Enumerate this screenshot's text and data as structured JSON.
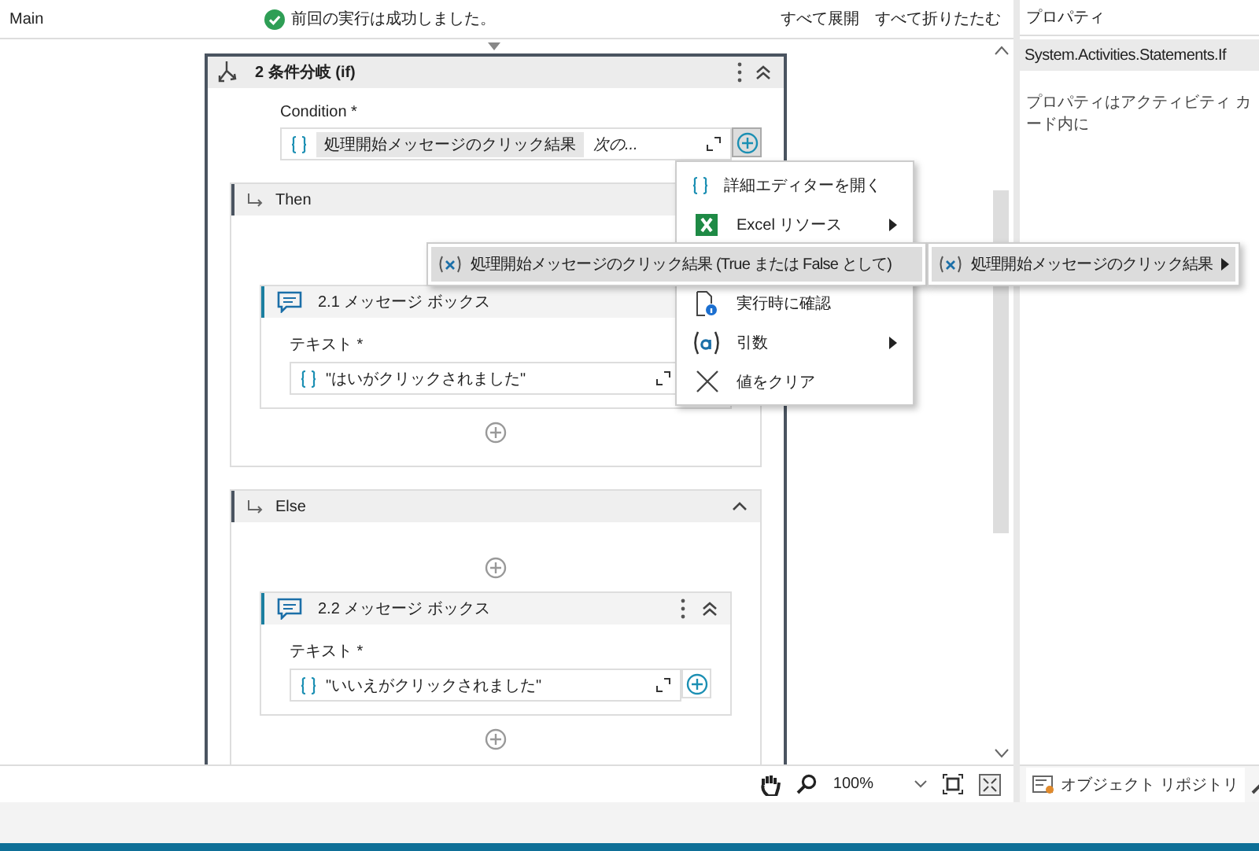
{
  "document": {
    "title": "Main",
    "status": "前回の実行は成功しました。",
    "actions": [
      "すべて展開",
      "すべて折りたたむ"
    ]
  },
  "if_activity": {
    "title": "2 条件分岐 (if)",
    "condition_label": "Condition *",
    "condition_variable": "処理開始メッセージのクリック結果",
    "condition_hint": "次の...",
    "branches": [
      {
        "label": "Then",
        "activity": {
          "title": "2.1 メッセージ ボックス",
          "field_label": "テキスト *",
          "value": "\"はいがクリックされました\""
        }
      },
      {
        "label": "Else",
        "activity": {
          "title": "2.2 メッセージ ボックス",
          "field_label": "テキスト *",
          "value": "\"いいえがクリックされました\""
        }
      }
    ]
  },
  "context_menu": {
    "items": [
      {
        "label": "詳細エディターを開く",
        "kind": "editor",
        "has_submenu": false
      },
      {
        "label": "Excel リソース",
        "kind": "excel",
        "has_submenu": true
      },
      {
        "label": "実行時に確認",
        "kind": "prompt",
        "has_submenu": false
      },
      {
        "label": "引数",
        "kind": "argument",
        "has_submenu": true
      },
      {
        "label": "値をクリア",
        "kind": "clear",
        "has_submenu": false
      }
    ]
  },
  "condition_submenu": {
    "items": [
      {
        "label": "処理開始メッセージのクリック結果 (True または False として)",
        "selected": true
      }
    ]
  },
  "variables_submenu": {
    "items": [
      {
        "label": "処理開始メッセージのクリック結果",
        "selected": true,
        "has_submenu": true
      }
    ]
  },
  "zoom": {
    "value": "100%"
  },
  "properties": {
    "title": "プロパティ",
    "type_name": "System.Activities.Statements.If",
    "message": "プロパティはアクティビティ カード内に"
  },
  "bottom_tabs": [
    "オブジェクト リポジトリ"
  ]
}
